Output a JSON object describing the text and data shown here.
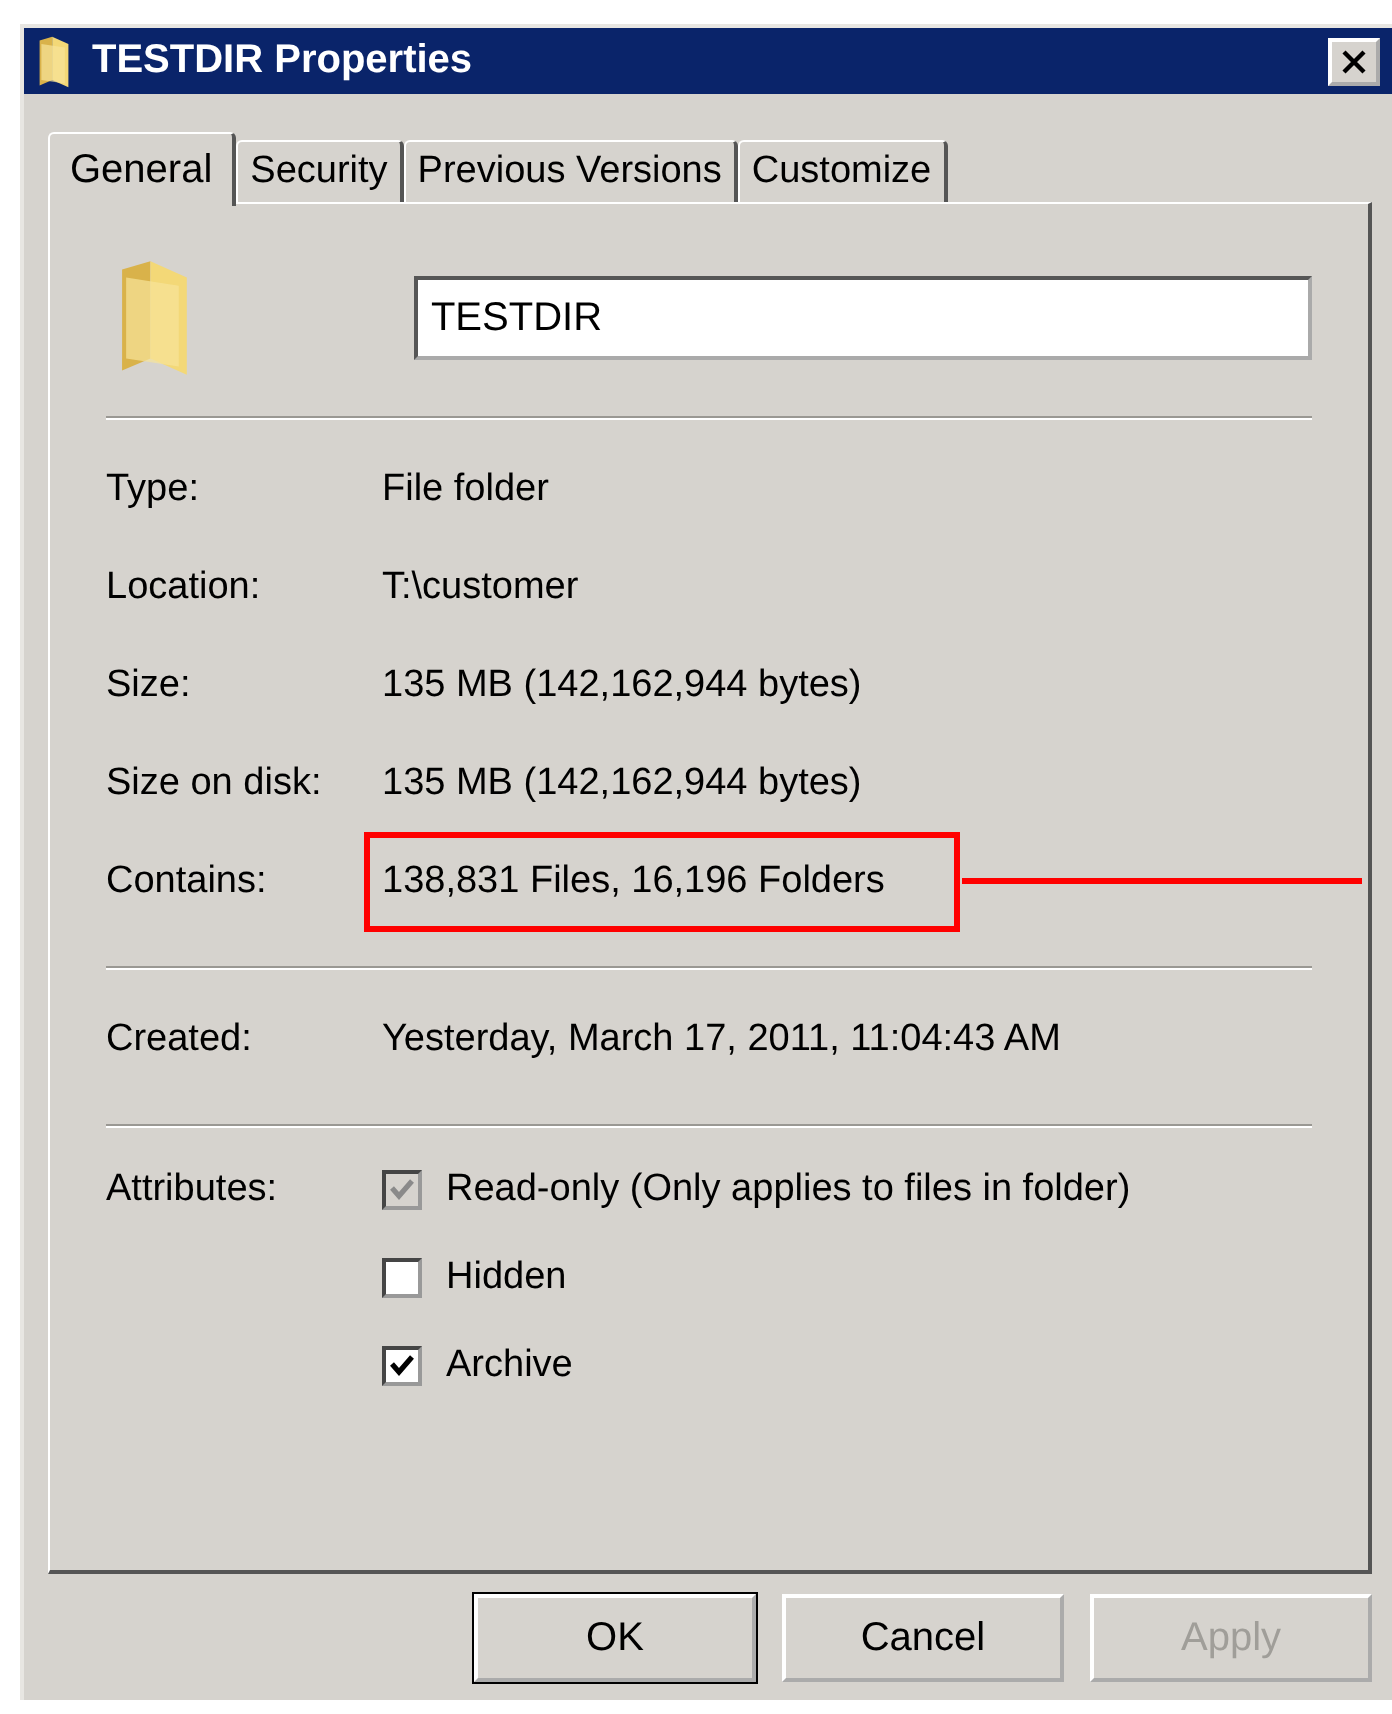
{
  "window": {
    "title": "TESTDIR Properties"
  },
  "tabs": [
    {
      "label": "General",
      "selected": true
    },
    {
      "label": "Security",
      "selected": false
    },
    {
      "label": "Previous Versions",
      "selected": false
    },
    {
      "label": "Customize",
      "selected": false
    }
  ],
  "name_field": {
    "value": "TESTDIR"
  },
  "sections": [
    {
      "rows": [
        {
          "label": "Type:",
          "value": "File folder",
          "highlighted": false
        },
        {
          "label": "Location:",
          "value": "T:\\customer",
          "highlighted": false
        },
        {
          "label": "Size:",
          "value": "135 MB (142,162,944 bytes)",
          "highlighted": false
        },
        {
          "label": "Size on disk:",
          "value": "135 MB (142,162,944 bytes)",
          "highlighted": false
        },
        {
          "label": "Contains:",
          "value": "138,831 Files, 16,196 Folders",
          "highlighted": true
        }
      ]
    },
    {
      "rows": [
        {
          "label": "Created:",
          "value": "Yesterday, March 17, 2011, 11:04:43 AM",
          "highlighted": false
        }
      ]
    }
  ],
  "attributes": {
    "label": "Attributes:",
    "options": [
      {
        "label": "Read-only (Only applies to files in folder)",
        "checked": true,
        "disabled": true
      },
      {
        "label": "Hidden",
        "checked": false,
        "disabled": false
      },
      {
        "label": "Archive",
        "checked": true,
        "disabled": false
      }
    ]
  },
  "buttons": [
    {
      "label": "OK",
      "default": true,
      "disabled": false
    },
    {
      "label": "Cancel",
      "default": false,
      "disabled": false
    },
    {
      "label": "Apply",
      "default": false,
      "disabled": true
    }
  ]
}
